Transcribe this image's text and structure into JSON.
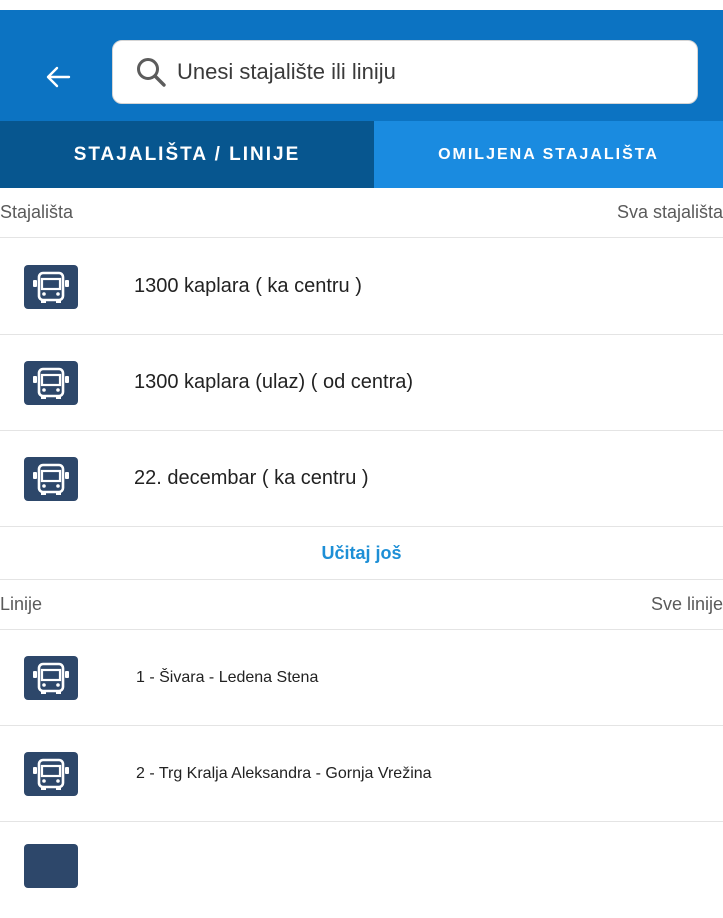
{
  "header": {
    "back_icon": "arrow-left-icon",
    "search": {
      "icon": "search-icon",
      "placeholder": "Unesi stajalište ili liniju",
      "value": ""
    }
  },
  "tabs": [
    {
      "label": "STAJALIŠTA / LINIJE",
      "active": true
    },
    {
      "label": "OMILJENA STAJALIŠTA",
      "active": false
    }
  ],
  "stops_section": {
    "title": "Stajališta",
    "link": "Sva stajališta",
    "items": [
      {
        "icon": "bus-icon",
        "label": "1300 kaplara ( ka centru )"
      },
      {
        "icon": "bus-icon",
        "label": "1300 kaplara (ulaz) ( od centra)"
      },
      {
        "icon": "bus-icon",
        "label": "22. decembar ( ka centru )"
      }
    ],
    "load_more": "Učitaj još"
  },
  "lines_section": {
    "title": "Linije",
    "link": "Sve linije",
    "items": [
      {
        "icon": "bus-icon",
        "label": "1 - Šivara - Ledena Stena"
      },
      {
        "icon": "bus-icon",
        "label": "2 - Trg Kralja Aleksandra - Gornja Vrežina"
      },
      {
        "icon": "bus-icon",
        "label": ""
      }
    ]
  },
  "colors": {
    "primary": "#0c73c2",
    "tab_active": "#07568f",
    "tab_inactive": "#1a8be0",
    "link": "#1d8fd6",
    "icon_bg": "#2d476a"
  }
}
